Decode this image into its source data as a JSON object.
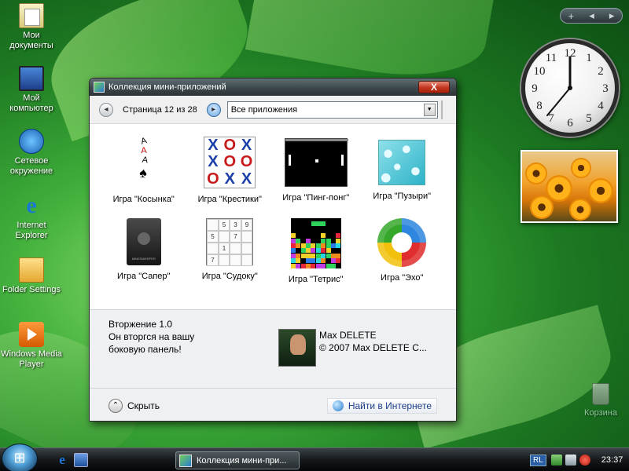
{
  "desktop": {
    "icons": [
      {
        "label": "Мои документы"
      },
      {
        "label": "Мой компьютер"
      },
      {
        "label": "Сетевое окружение"
      },
      {
        "label": "Internet Explorer"
      },
      {
        "label": "Folder Settings"
      },
      {
        "label": "Windows Media Player"
      }
    ],
    "recycle_bin": "Корзина"
  },
  "sidebar": {
    "add_symbol": "+",
    "prev_symbol": "◂",
    "next_symbol": "▸"
  },
  "clock_gadget": {
    "numerals": [
      "12",
      "1",
      "2",
      "3",
      "4",
      "5",
      "6",
      "7",
      "8",
      "9",
      "10",
      "11"
    ],
    "time": "23:37"
  },
  "gallery_window": {
    "title": "Коллекция мини-приложений",
    "close_symbol": "X",
    "page_label": "Страница 12 из 28",
    "prev_symbol": "◂",
    "next_symbol": "▸",
    "filter_value": "Все приложения",
    "dropdown_symbol": "▼",
    "gadgets": [
      {
        "label": "Игра \"Косынка\"",
        "icon": "solitaire-cards-icon"
      },
      {
        "label": "Игра \"Крестики\"",
        "icon": "tic-tac-toe-icon"
      },
      {
        "label": "Игра \"Пинг-понг\"",
        "icon": "pong-icon"
      },
      {
        "label": "Игра \"Пузыри\"",
        "icon": "bubbles-icon"
      },
      {
        "label": "Игра \"Сапер\"",
        "icon": "minesweeper-icon"
      },
      {
        "label": "Игра \"Судоку\"",
        "icon": "sudoku-icon"
      },
      {
        "label": "Игра \"Тетрис\"",
        "icon": "tetris-icon"
      },
      {
        "label": "Игра \"Эхо\"",
        "icon": "echo-icon"
      }
    ],
    "details": {
      "name": "Вторжение 1.0",
      "description_line1": "Он вторгся на вашу",
      "description_line2": "боковую панель!",
      "author": "Max DELETE",
      "copyright": "© 2007 Max DELETE C..."
    },
    "hide_label": "Скрыть",
    "online_label": "Найти в Интернете"
  },
  "taskbar": {
    "task_label": "Коллекция мини-при...",
    "lang": "RL",
    "time": "23:37"
  }
}
